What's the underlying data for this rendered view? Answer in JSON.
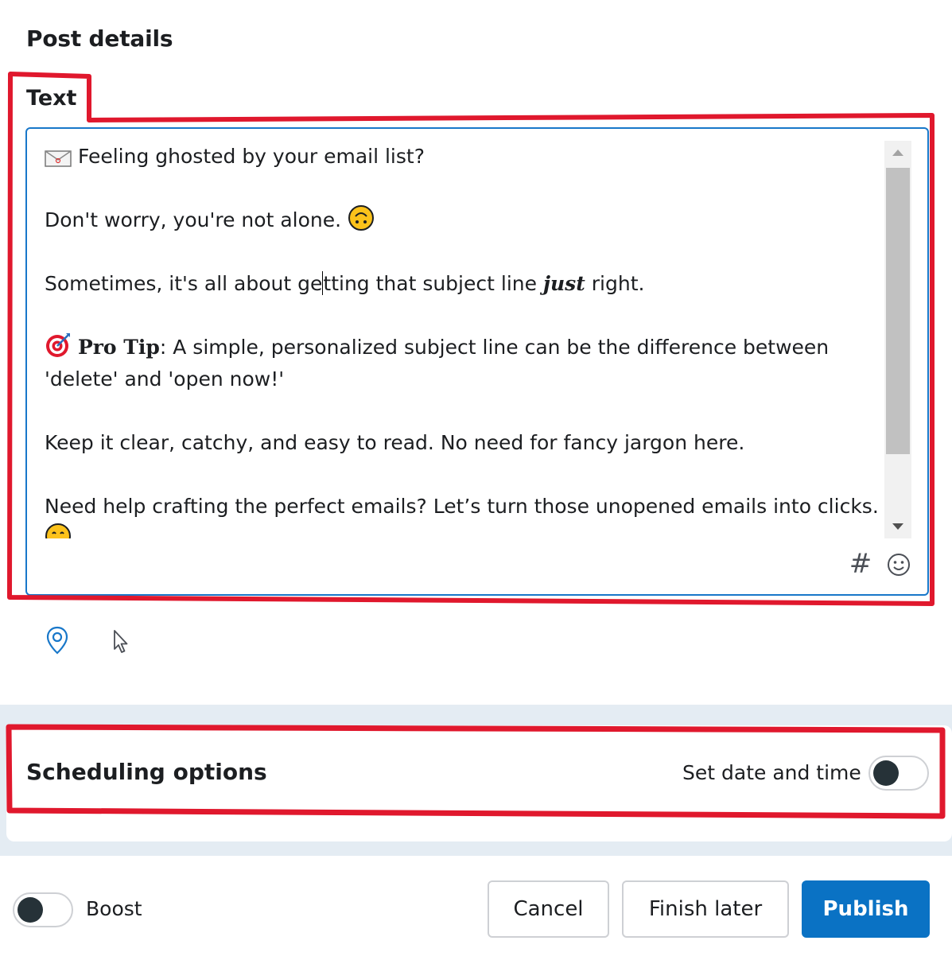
{
  "post_details": {
    "title": "Post details",
    "text_label": "Text",
    "text_lines": {
      "l1": "Feeling ghosted by your email list?",
      "l2": "Don't worry, you're not alone.",
      "l3_a": "Sometimes, it's all about ge",
      "l3_b": "tting that subject line ",
      "l3_just": "just",
      "l3_c": " right.",
      "l4_pro": "Pro Tip",
      "l4_rest": ": A simple, personalized subject line can be the difference between",
      "l5": "'delete' and 'open now!'",
      "l6": "Keep it clear, catchy, and easy to read. No need for fancy jargon here.",
      "l7": "Need help crafting the perfect emails? Let’s turn those unopened emails into clicks."
    },
    "hashtag_symbol": "#",
    "icons": {
      "envelope": "envelope-icon",
      "upside_down_face": "upside-down-face-icon",
      "target": "direct-hit-icon",
      "smile": "smiling-face-icon",
      "emoji_picker": "emoji-picker-icon",
      "location": "location-pin-icon",
      "cursor": "cursor-icon"
    },
    "accent_color": "#1877c9"
  },
  "scheduling": {
    "title": "Scheduling options",
    "set_date_label": "Set date and time",
    "set_date_enabled": false
  },
  "footer": {
    "boost_label": "Boost",
    "boost_enabled": false,
    "cancel_label": "Cancel",
    "finish_later_label": "Finish later",
    "publish_label": "Publish",
    "publish_color": "#0a72c4"
  },
  "annotation_color": "#e0182d"
}
